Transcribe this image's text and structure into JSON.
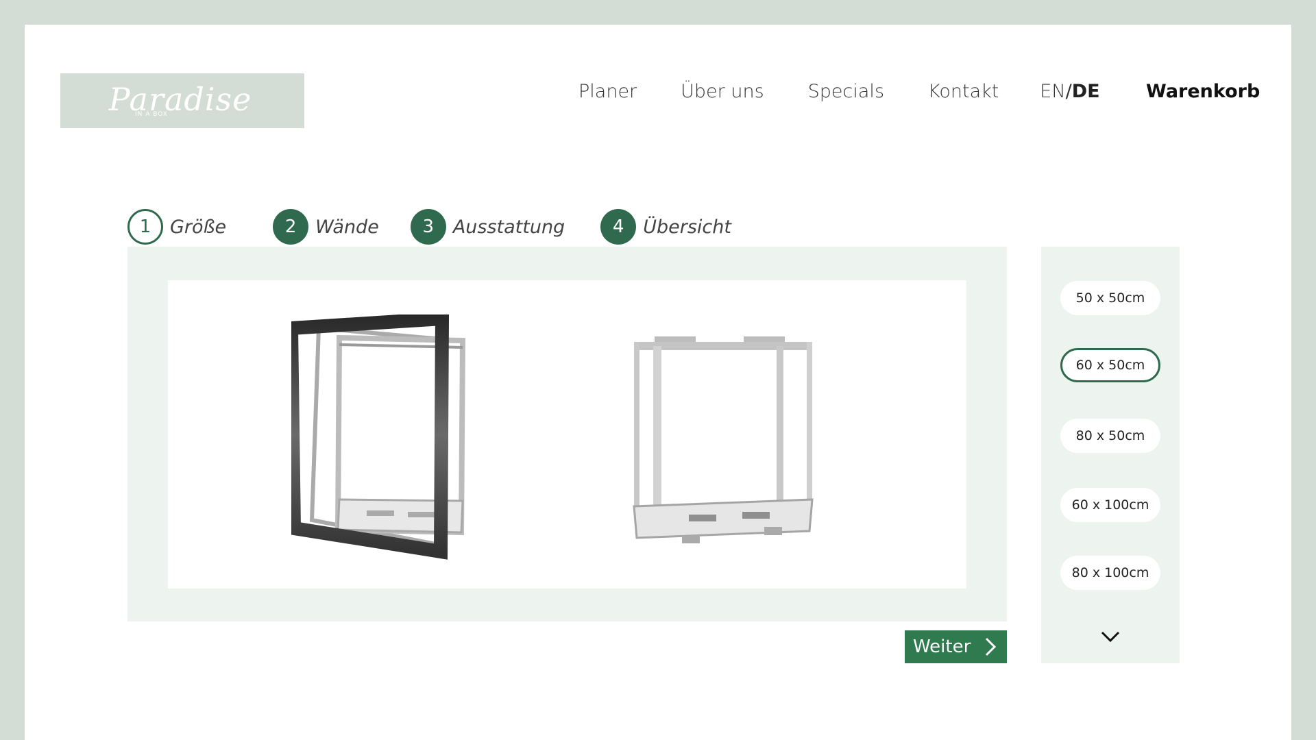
{
  "brand": {
    "logo_text": "Paradise",
    "logo_sub": "IN A BOX"
  },
  "nav": {
    "items": [
      "Planer",
      "Über uns",
      "Specials",
      "Kontakt"
    ],
    "lang_en": "EN",
    "lang_sep": "/",
    "lang_de": "DE",
    "cart": "Warenkorb"
  },
  "steps": [
    {
      "num": "1",
      "label": "Größe",
      "active": true
    },
    {
      "num": "2",
      "label": "Wände",
      "active": false
    },
    {
      "num": "3",
      "label": "Ausstattung",
      "active": false
    },
    {
      "num": "4",
      "label": "Übersicht",
      "active": false
    }
  ],
  "next_button": {
    "label": "Weiter"
  },
  "sizes": {
    "options": [
      "50 x 50cm",
      "60 x 50cm",
      "80 x 50cm",
      "60 x 100cm",
      "80 x 100cm"
    ],
    "selected": "60 x 50cm"
  },
  "colors": {
    "accent": "#2f6a4f",
    "panel": "#edf3ee",
    "background": "#d3dcd5"
  },
  "icons": {
    "next": "chevron-right-icon",
    "more": "chevron-down-icon"
  }
}
